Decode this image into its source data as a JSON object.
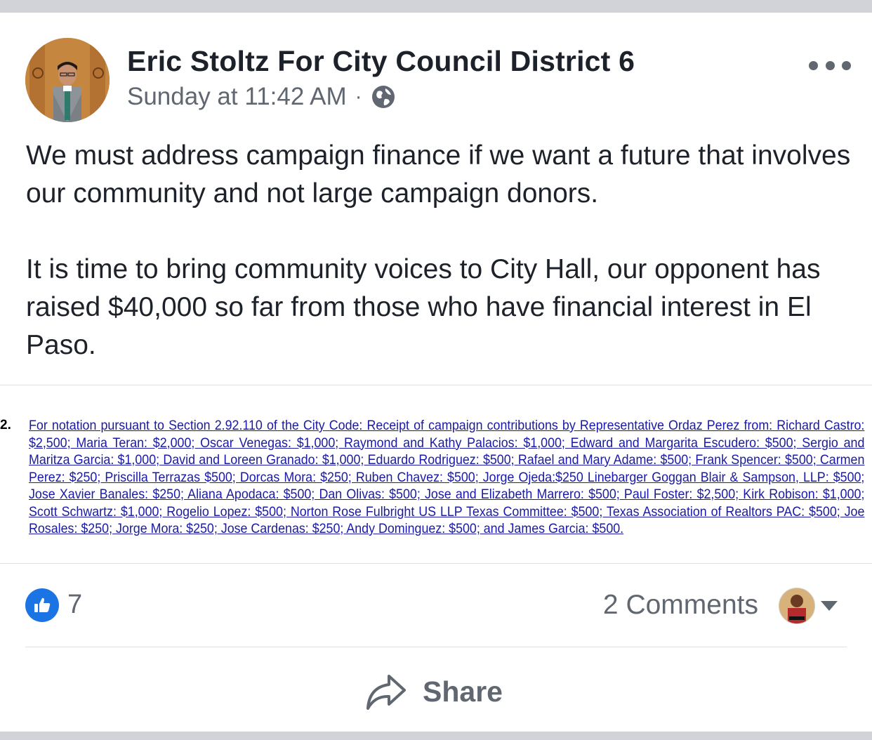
{
  "post": {
    "page_name": "Eric Stoltz For City Council District 6",
    "timestamp": "Sunday at 11:42 AM",
    "separator": "·",
    "privacy_icon": "globe-icon",
    "more_icon": "more-options-icon",
    "body": [
      "We must address campaign finance if we want a future that involves our community and not large campaign donors.",
      "It is time to bring community voices to City Hall, our opponent has raised $40,000 so far from those who have financial interest in El Paso."
    ]
  },
  "attachment": {
    "item_number": "2.",
    "text": "For notation pursuant to Section 2.92.110 of the City Code: Receipt of  campaign contributions by Representative Ordaz Perez from: Richard Castro: $2,500; Maria Teran: $2,000; Oscar Venegas: $1,000; Raymond and Kathy Palacios: $1,000; Edward and Margarita Escudero: $500; Sergio and Maritza Garcia: $1,000; David and Loreen Granado: $1,000; Eduardo Rodriguez: $500; Rafael and Mary Adame: $500; Frank Spencer: $500; Carmen Perez: $250; Priscilla Terrazas $500; Dorcas Mora: $250; Ruben Chavez: $500; Jorge Ojeda:$250 Linebarger Goggan Blair & Sampson, LLP: $500; Jose Xavier Banales: $250; Aliana Apodaca: $500; Dan Olivas: $500; Jose and Elizabeth Marrero: $500; Paul Foster: $2,500; Kirk Robison: $1,000; Scott Schwartz: $1,000; Rogelio Lopez: $500; Norton Rose Fulbright US LLP Texas Committee: $500; Texas Association of Realtors PAC: $500; Joe Rosales: $250; Jorge Mora: $250; Jose Cardenas: $250; Andy Dominguez: $500; and James Garcia: $500."
  },
  "footer": {
    "like_icon": "thumbs-up-icon",
    "like_count": "7",
    "comments_label": "2 Comments",
    "share_label": "Share",
    "share_icon": "share-arrow-icon"
  },
  "colors": {
    "accent": "#1b74e4",
    "link_text": "#1a1aa6",
    "secondary_text": "#606770",
    "primary_text": "#1d2129",
    "frame": "#d1d3d8"
  }
}
